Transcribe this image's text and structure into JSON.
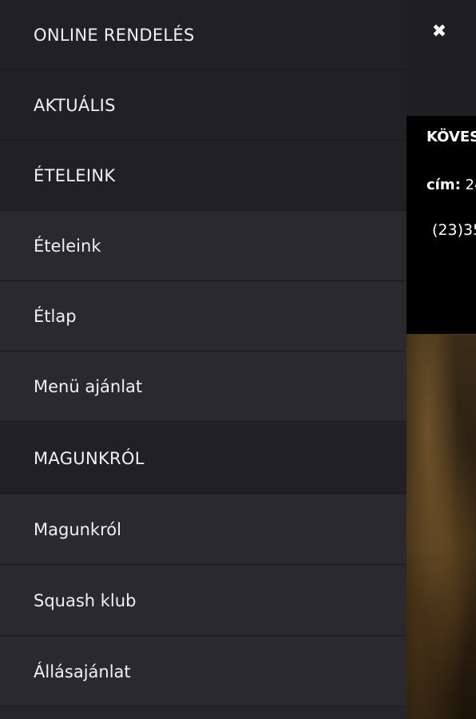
{
  "menu": {
    "items": [
      {
        "label": "ONLINE RENDELÉS",
        "type": "section"
      },
      {
        "label": "AKTUÁLIS",
        "type": "section"
      },
      {
        "label": "ÉTELEINK",
        "type": "section"
      },
      {
        "label": "Ételeink",
        "type": "sub"
      },
      {
        "label": "Étlap",
        "type": "sub"
      },
      {
        "label": "Menü ajánlat",
        "type": "sub"
      },
      {
        "label": "MAGUNKRÓL",
        "type": "section"
      },
      {
        "label": "Magunkról",
        "type": "sub"
      },
      {
        "label": "Squash klub",
        "type": "sub"
      },
      {
        "label": "Állásajánlat",
        "type": "sub"
      }
    ]
  },
  "header": {
    "close_icon": "close-icon",
    "close_glyph": "✖"
  },
  "info": {
    "title": "KÖVES",
    "address_label": "cím:",
    "address_value": "24",
    "phone": "(23)35"
  },
  "colors": {
    "menu_bg": "#25252a",
    "text": "#f2f2f2",
    "topbar_bg": "#1f1f23"
  }
}
